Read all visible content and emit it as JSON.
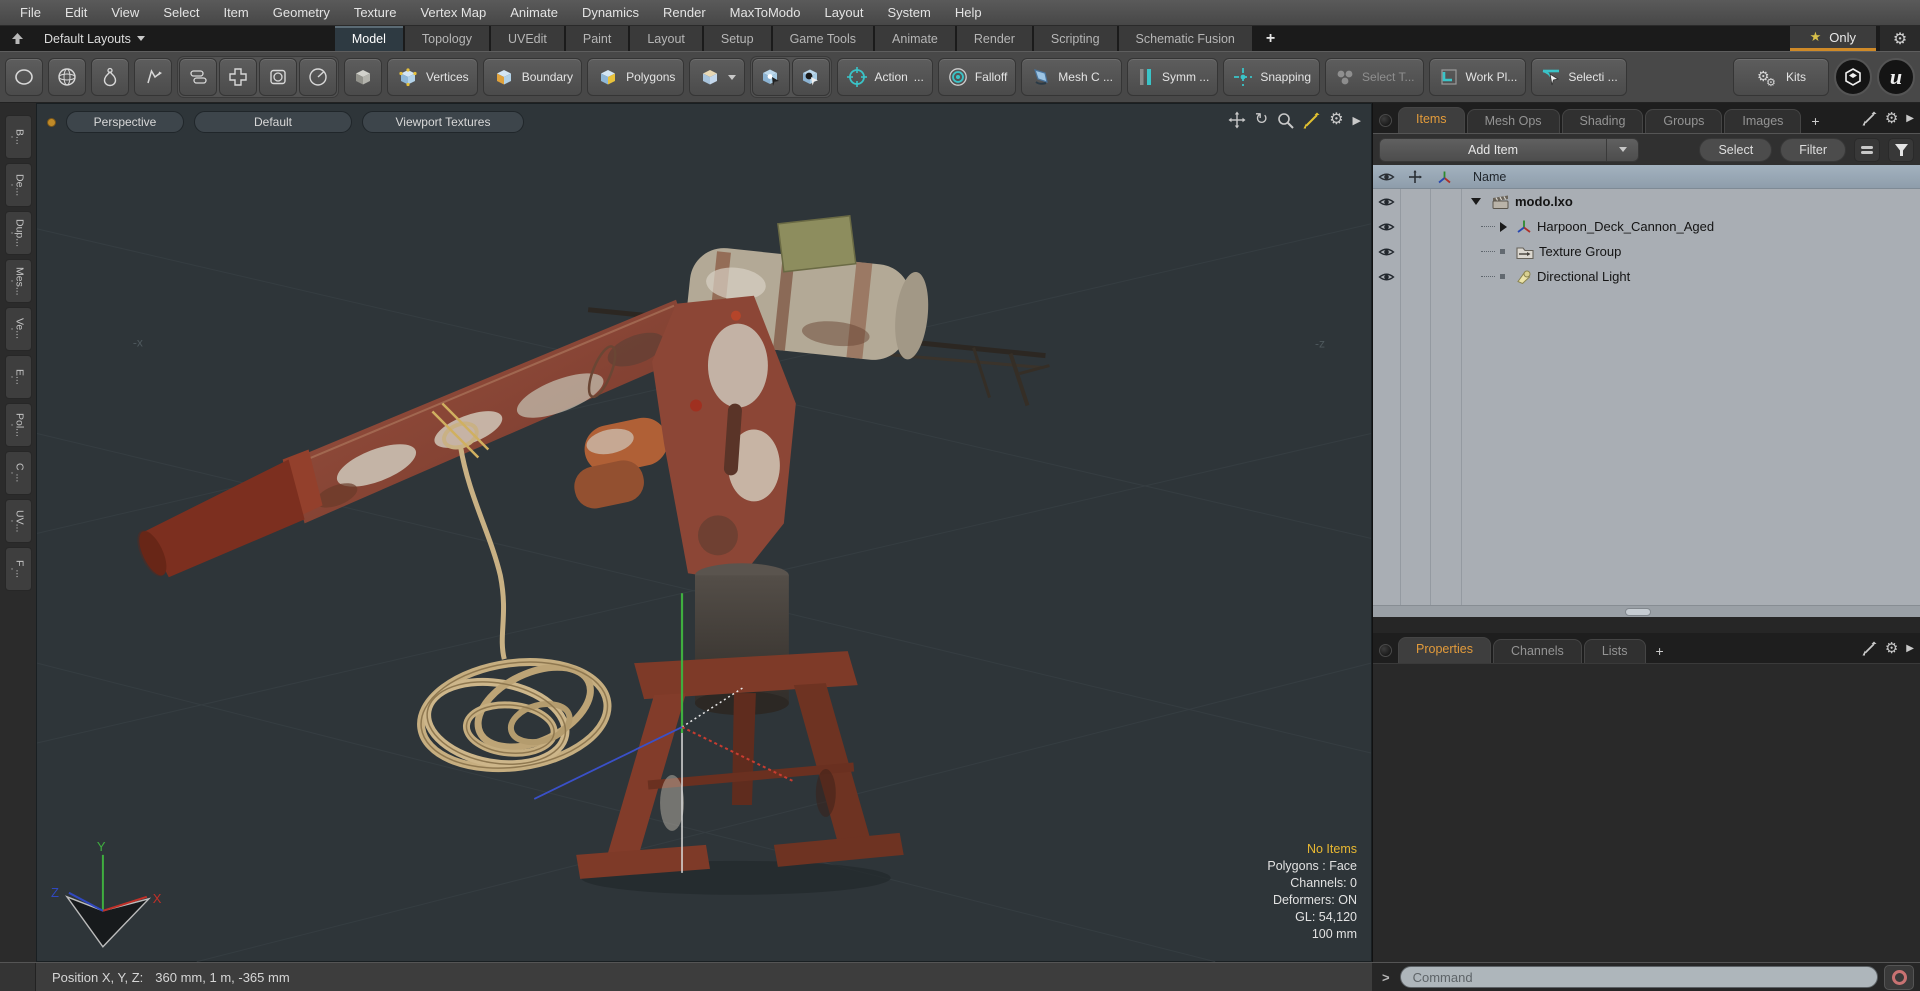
{
  "menubar": {
    "items": [
      "File",
      "Edit",
      "View",
      "Select",
      "Item",
      "Geometry",
      "Texture",
      "Vertex Map",
      "Animate",
      "Dynamics",
      "Render",
      "MaxToModo",
      "Layout",
      "System",
      "Help"
    ]
  },
  "layout_bar": {
    "layouts_label": "Default Layouts",
    "tabs": [
      "Model",
      "Topology",
      "UVEdit",
      "Paint",
      "Layout",
      "Setup",
      "Game Tools",
      "Animate",
      "Render",
      "Scripting",
      "Schematic Fusion"
    ],
    "active_tab": "Model",
    "add_tab_label": "+",
    "star_glyph": "★",
    "only_label": "Only"
  },
  "toolbar": {
    "vertices": "Vertices",
    "boundary": "Boundary",
    "polygons": "Polygons",
    "action": "Action",
    "action_more": "...",
    "falloff": "Falloff",
    "mesh_constraint": "Mesh C ...",
    "symmetry": "Symm ...",
    "snapping": "Snapping",
    "select_through": "Select T...",
    "work_plane": "Work Pl...",
    "selection_sets": "Selecti ...",
    "kits": "Kits"
  },
  "left_toolbox": {
    "tabs": [
      "B...",
      "De...",
      "Dup...",
      "Mes...",
      "Ve...",
      "E...",
      "Pol...",
      "C ...",
      "UV...",
      "F ..."
    ]
  },
  "viewport": {
    "header_buttons": [
      "Perspective",
      "Default",
      "Viewport Textures"
    ],
    "axis_markers": {
      "left": "-x",
      "right": "-z"
    },
    "gizmo": {
      "x": "X",
      "y": "Y",
      "z": "Z"
    },
    "stats": {
      "selection": "No Items",
      "polygons": "Polygons : Face",
      "channels": "Channels: 0",
      "deformers": "Deformers: ON",
      "gl": "GL: 54,120",
      "grid_size": "100 mm"
    }
  },
  "right_panel": {
    "tabs": [
      "Items",
      "Mesh Ops",
      "Shading",
      "Groups",
      "Images"
    ],
    "active_tab": "Items",
    "add_tab_label": "+",
    "add_item_label": "Add Item",
    "select_label": "Select",
    "filter_label": "Filter",
    "tree": {
      "name_header": "Name",
      "rows": [
        {
          "label": "modo.lxo"
        },
        {
          "label": "Harpoon_Deck_Cannon_Aged"
        },
        {
          "label": "Texture Group"
        },
        {
          "label": "Directional Light"
        }
      ]
    },
    "lower_tabs": [
      "Properties",
      "Channels",
      "Lists"
    ],
    "active_lower_tab": "Properties",
    "lower_add_tab_label": "+"
  },
  "status_bar": {
    "position_label": "Position X, Y, Z:",
    "position_value": "360 mm, 1 m, -365 mm"
  },
  "command_bar": {
    "prompt": ">",
    "placeholder": "Command"
  },
  "colors": {
    "accent_orange": "#e29b3b",
    "accent_teal": "#3ac4c8",
    "tree_bg": "#a9aeb4",
    "viewport_bg": "#2e3539"
  }
}
